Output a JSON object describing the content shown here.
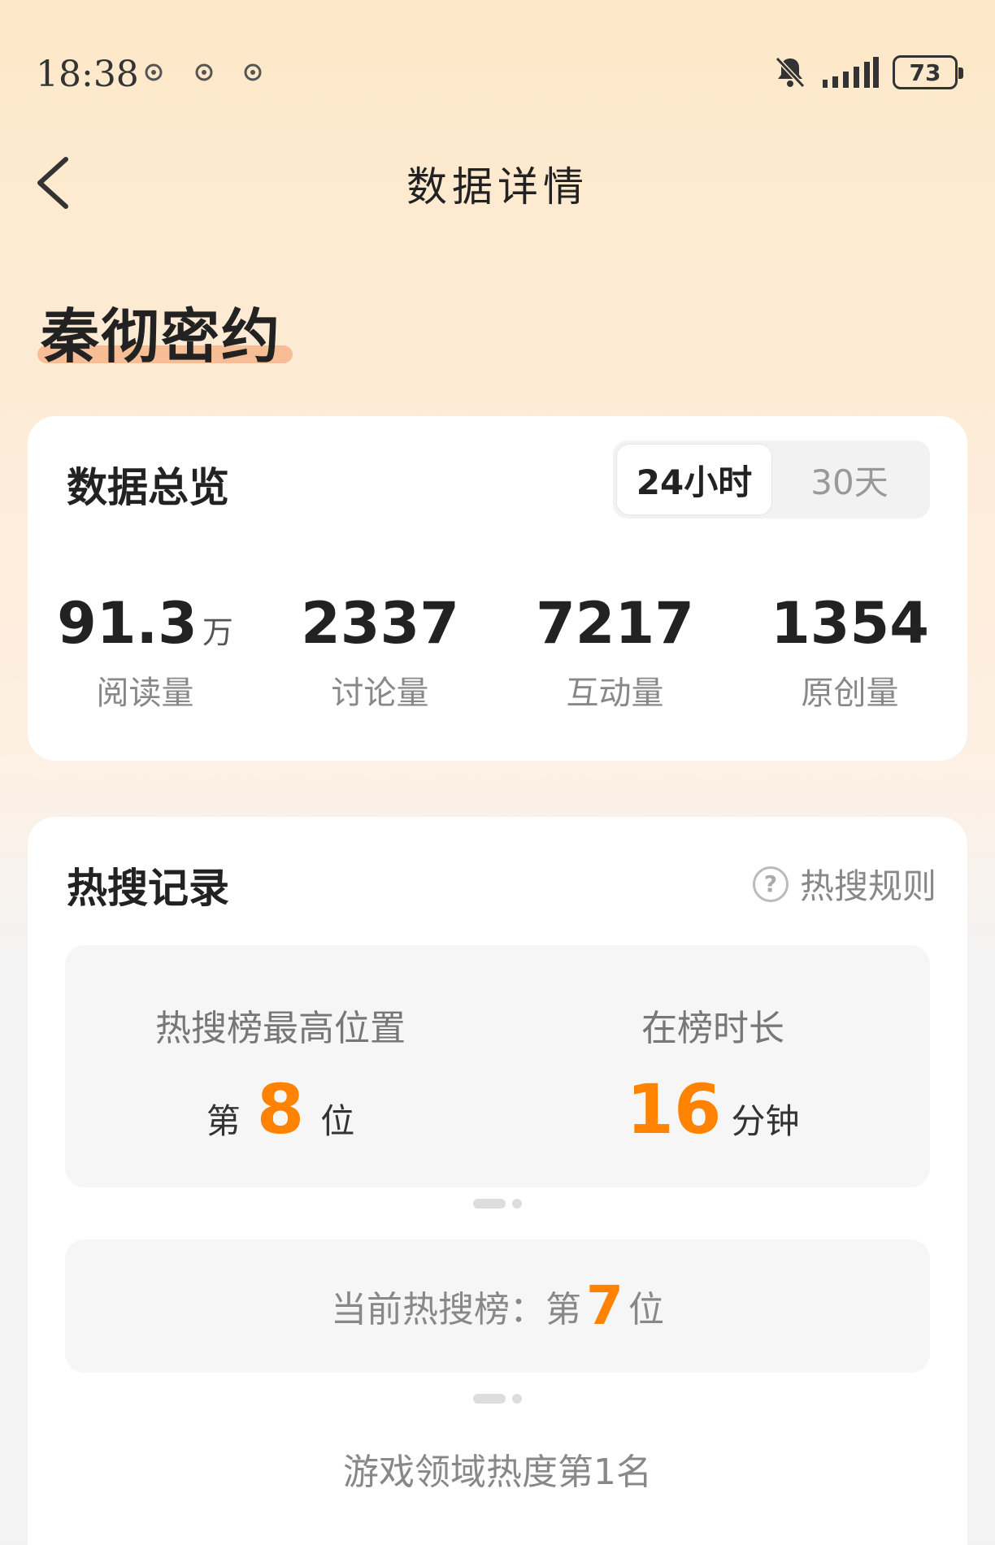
{
  "status_bar": {
    "time": "18:38",
    "battery": "73"
  },
  "nav": {
    "title": "数据详情"
  },
  "topic": {
    "title": "秦彻密约"
  },
  "overview": {
    "heading": "数据总览",
    "tabs": [
      {
        "label": "24小时",
        "active": true
      },
      {
        "label": "30天",
        "active": false
      }
    ],
    "stats": [
      {
        "value": "91.3",
        "unit": "万",
        "label": "阅读量"
      },
      {
        "value": "2337",
        "unit": "",
        "label": "讨论量"
      },
      {
        "value": "7217",
        "unit": "",
        "label": "互动量"
      },
      {
        "value": "1354",
        "unit": "",
        "label": "原创量"
      }
    ]
  },
  "hot": {
    "heading": "热搜记录",
    "rules_label": "热搜规则",
    "peak_label": "热搜榜最高位置",
    "peak_prefix": "第",
    "peak_value": "8",
    "peak_suffix": "位",
    "duration_label": "在榜时长",
    "duration_value": "16",
    "duration_unit": "分钟",
    "current_prefix": "当前热搜榜：第",
    "current_value": "7",
    "current_suffix": "位",
    "domain_rank": "游戏领域热度第1名"
  },
  "colors": {
    "accent": "#ff8200",
    "underline": "#f6b68a"
  }
}
